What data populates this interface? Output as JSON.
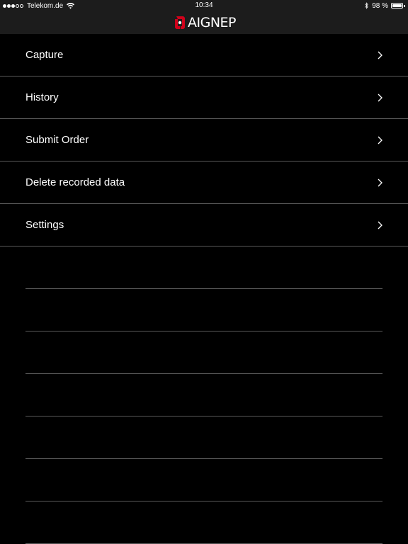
{
  "status_bar": {
    "carrier": "Telekom.de",
    "time": "10:34",
    "battery": "98 %",
    "battery_level": 0.98,
    "signal_bars_filled": 3,
    "signal_bars_total": 5
  },
  "nav": {
    "logo_text": "AIGNEP",
    "logo_color": "#d0021b"
  },
  "menu": {
    "items": [
      {
        "label": "Capture"
      },
      {
        "label": "History"
      },
      {
        "label": "Submit Order"
      },
      {
        "label": "Delete recorded data"
      },
      {
        "label": "Settings"
      }
    ]
  },
  "icons": {
    "chevron": "chevron-right-icon",
    "wifi": "wifi-icon",
    "bluetooth": "bluetooth-icon",
    "battery": "battery-icon"
  }
}
